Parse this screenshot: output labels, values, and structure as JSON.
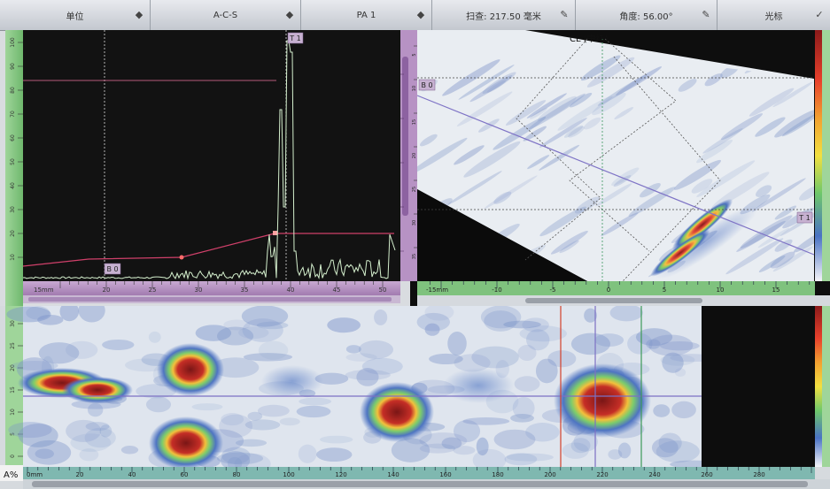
{
  "toolbar": {
    "items": [
      {
        "label": "单位",
        "icon": "diamond-arrow-icon"
      },
      {
        "label": "A-C-S",
        "icon": "diamond-arrow-icon"
      },
      {
        "label": "PA 1",
        "icon": "diamond-arrow-icon"
      },
      {
        "label": "扫查: 217.50 毫米",
        "icon": "pencil-icon"
      },
      {
        "label": "角度: 56.00°",
        "icon": "pencil-icon"
      },
      {
        "label": "光标",
        "icon": "check-icon"
      }
    ]
  },
  "ascan": {
    "cursor_t1": "T 1",
    "cursor_b0": "B 0",
    "unit_label": "15mm",
    "x_ticks": [
      "20",
      "25",
      "30",
      "35",
      "40",
      "45",
      "50"
    ],
    "y_ticks": [
      "10",
      "20",
      "30",
      "40",
      "50",
      "60",
      "70",
      "80",
      "90",
      "100"
    ]
  },
  "sscan": {
    "cl_label": "CL (中线)",
    "cursor_b0": "B 0",
    "cursor_t1": "T 1",
    "unit_label": "-15mm",
    "x_ticks": [
      "-10",
      "-5",
      "0",
      "5",
      "10",
      "15"
    ],
    "y_ticks": [
      "5",
      "10",
      "15",
      "20",
      "25",
      "30",
      "35"
    ]
  },
  "cscan": {
    "corner_label": "A%",
    "unit_label": "0mm",
    "x_ticks": [
      "20",
      "40",
      "60",
      "80",
      "100",
      "120",
      "140",
      "160",
      "180",
      "200",
      "220",
      "240",
      "260",
      "280"
    ],
    "y_ticks": [
      "0",
      "5",
      "10",
      "15",
      "20",
      "25",
      "30"
    ]
  },
  "colors": {
    "toolbar": "#d1d5da",
    "ascan_bg": "#111111",
    "signal": "#d8f0d0",
    "gate": "#c9436a",
    "ruler_green": "#7bc47a",
    "ruler_purple": "#b68fc1",
    "ruler_teal": "#7fb6b0"
  }
}
